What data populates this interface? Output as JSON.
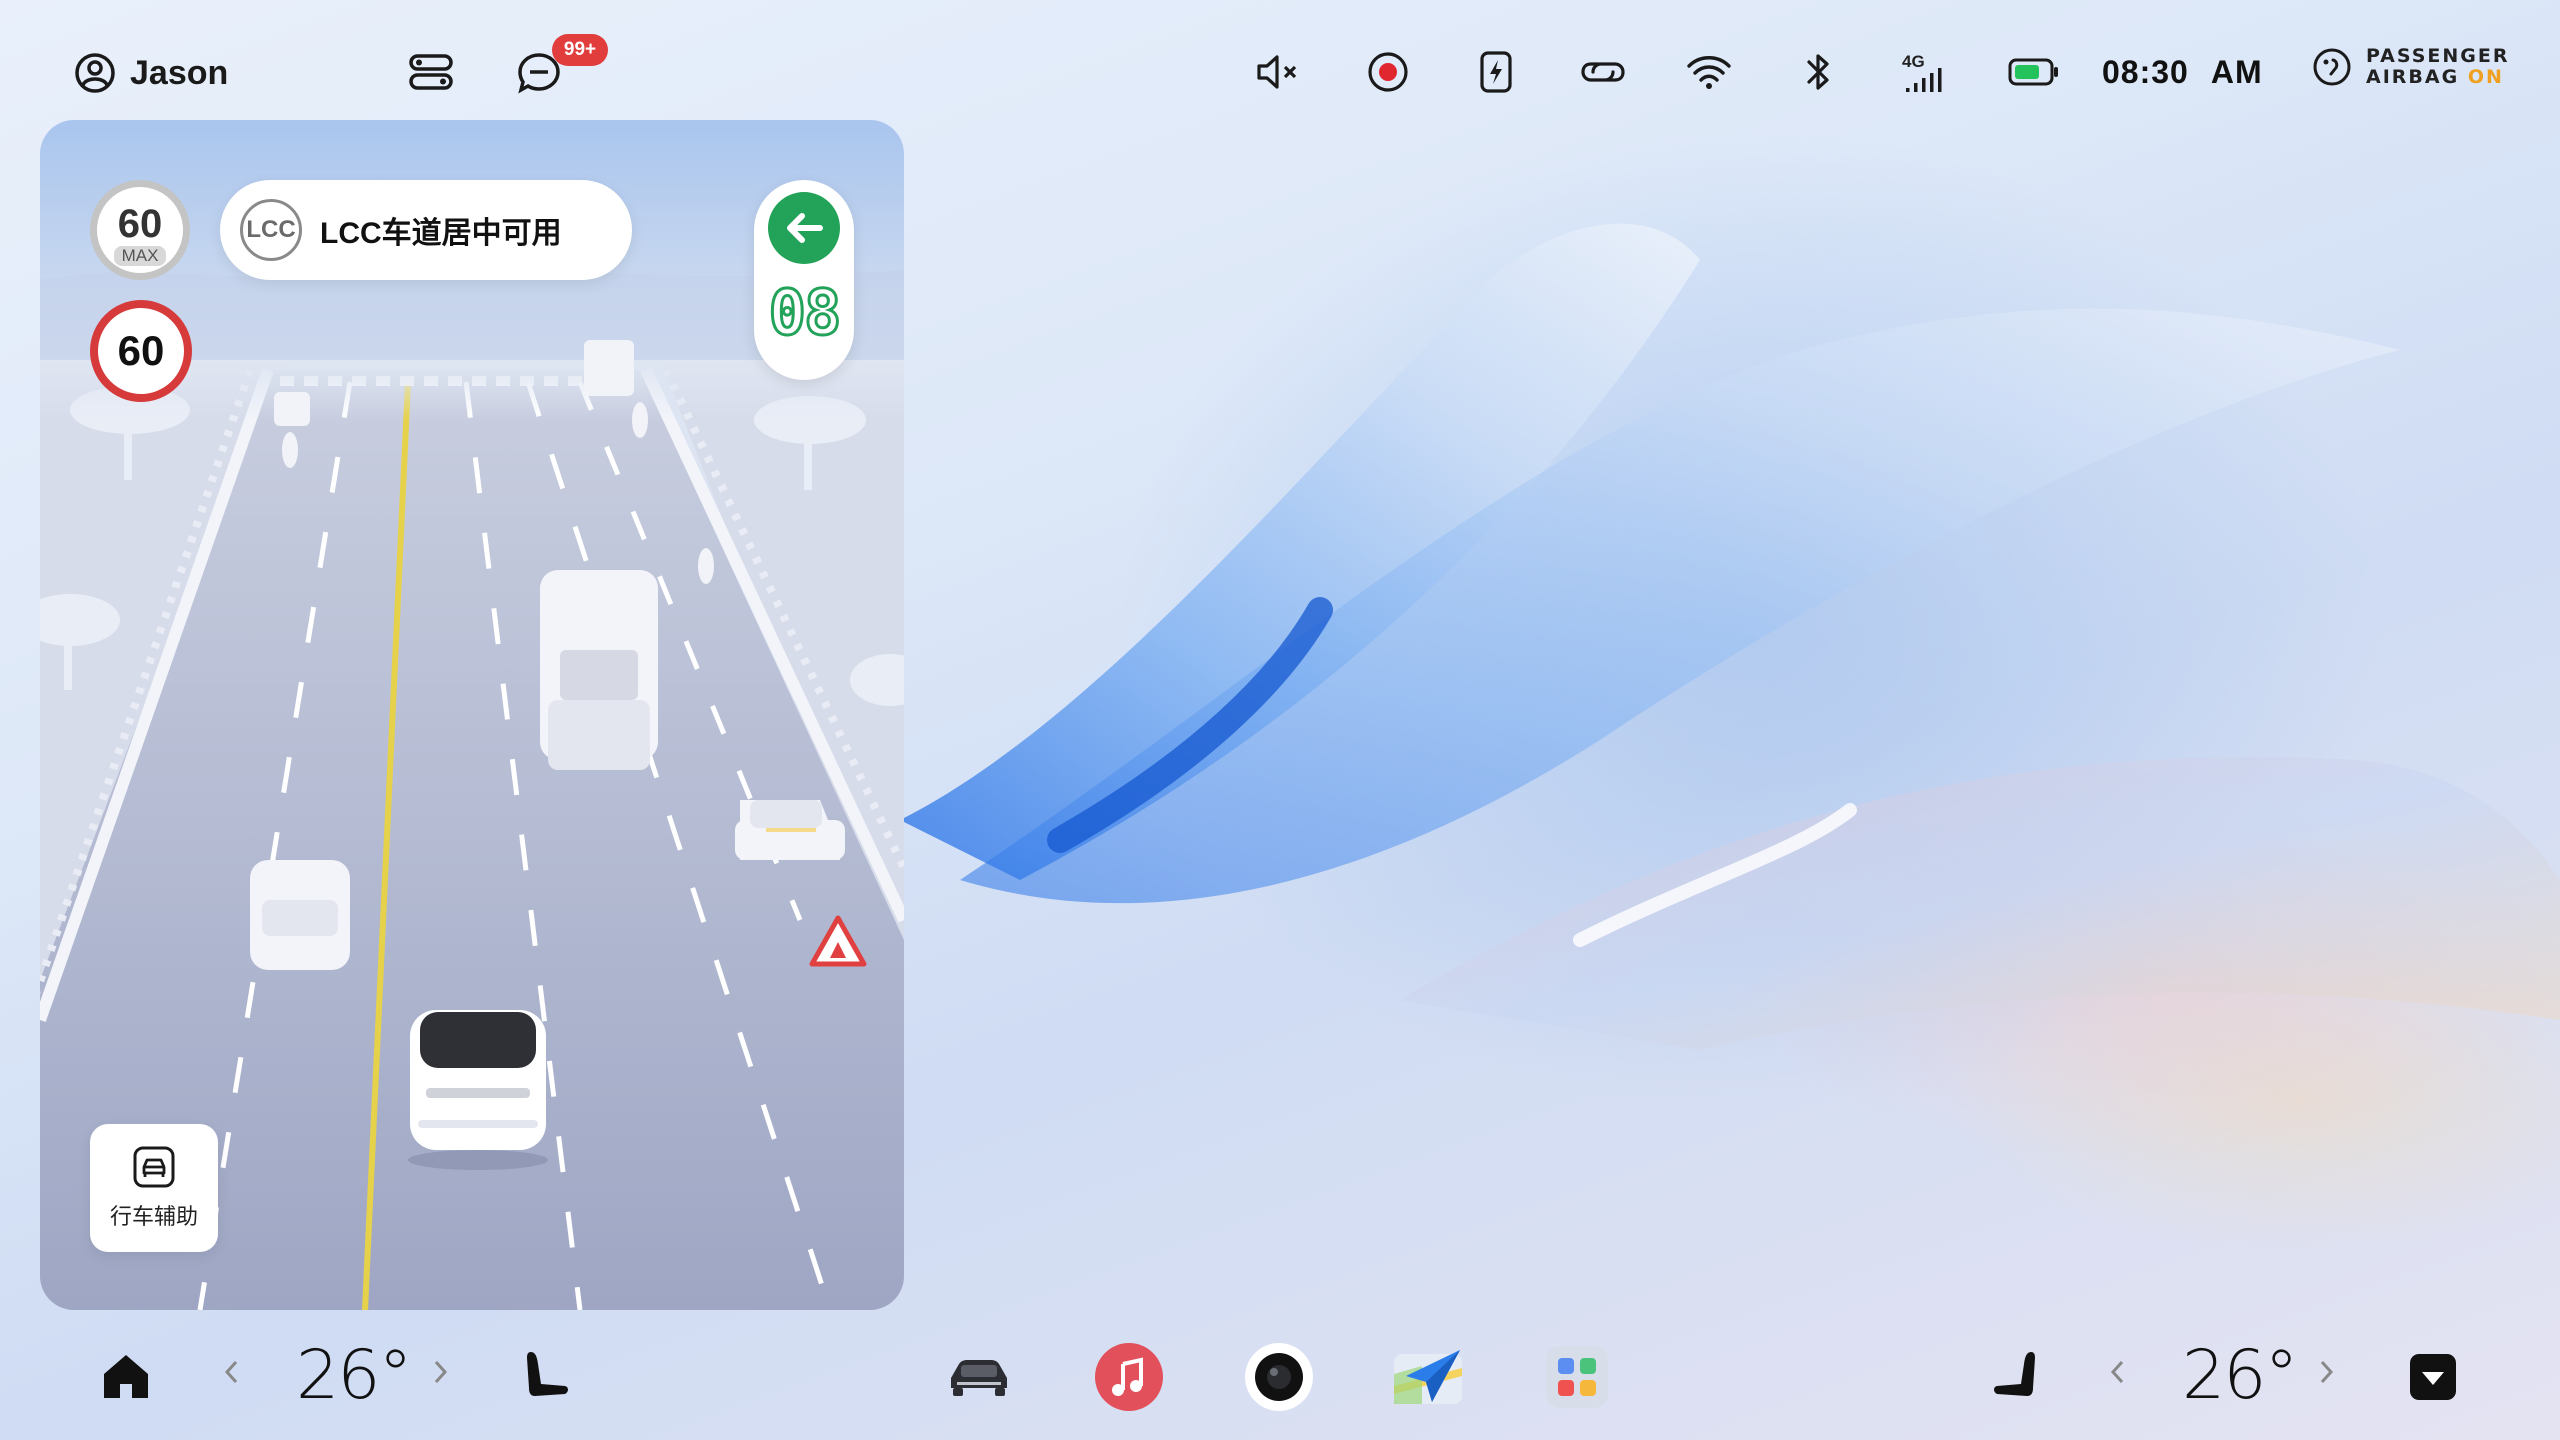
{
  "status_bar": {
    "user_name": "Jason",
    "notification_badge": "99+",
    "network_label": "4G",
    "time": "08:30",
    "ampm": "AM",
    "airbag_line1": "PASSENGER",
    "airbag_line2": "AIRBAG",
    "airbag_state": "ON",
    "icons": [
      "user-icon",
      "driver-profile-icon",
      "message-icon",
      "mute-icon",
      "record-icon",
      "charging-icon",
      "link-icon",
      "wifi-icon",
      "bluetooth-icon",
      "cellular-4g-icon",
      "battery-icon",
      "airbag-icon"
    ],
    "colors": {
      "badge": "#e23d3d",
      "airbag_on": "#f0a020",
      "battery": "#23c25a"
    }
  },
  "driving_assist": {
    "speed_sign_value": "60",
    "speed_sign_sub": "MAX",
    "speed_limit_value": "60",
    "lcc_badge": "LCC",
    "lcc_status": "LCC车道居中可用",
    "traffic_light_countdown": "08",
    "traffic_light_direction": "left-arrow",
    "assist_button_label": "行车辅助",
    "colors": {
      "traffic_green": "#23a25a",
      "limit_red": "#d63a3a"
    }
  },
  "dock": {
    "left_temp": "26°",
    "right_temp": "26°",
    "items": [
      "home-icon",
      "seat-left-icon",
      "car-icon",
      "music-icon",
      "camera-icon",
      "maps-icon",
      "apps-icon",
      "seat-right-icon",
      "dropdown-icon"
    ]
  }
}
